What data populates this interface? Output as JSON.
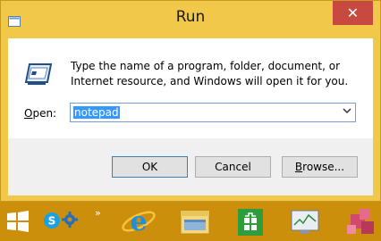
{
  "window": {
    "title": "Run",
    "close_glyph": "✕",
    "description": "Type the name of a program, folder, document, or Internet resource, and Windows will open it for you.",
    "open_label_prefix": "",
    "open_label_accel": "O",
    "open_label_rest": "pen:",
    "open_value": "notepad",
    "buttons": {
      "ok": "OK",
      "cancel": "Cancel",
      "browse_accel": "B",
      "browse_rest": "rowse..."
    }
  },
  "taskbar": {
    "chevron": "»",
    "items": [
      "start-icon",
      "skype-icon",
      "settings-icon",
      "internet-explorer-icon",
      "file-explorer-icon",
      "store-icon",
      "monitor-icon",
      "package-icon"
    ]
  },
  "colors": {
    "frame": "#f2c84b",
    "taskbar": "#cc8f0c",
    "close": "#c7493f",
    "selection": "#3399ff"
  }
}
